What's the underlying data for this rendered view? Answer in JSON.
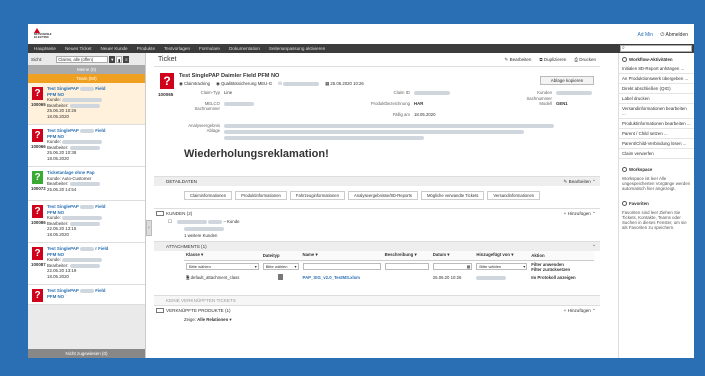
{
  "brand": {
    "logo_text": "MITSUBISHI ELECTRIC"
  },
  "user": {
    "name": "Ad Min",
    "logout": "Abmelden"
  },
  "nav": [
    "Hauptseite",
    "Neues Ticket",
    "Neuer Kunde",
    "Produkte",
    "Textvorlagen",
    "Formulare",
    "Dokumentation",
    "Seitenanpassung aktivieren"
  ],
  "left": {
    "sicht_label": "Sicht:",
    "sicht_value": "Claims, alle (offen)",
    "meine": "Meine (0)",
    "team": "Team (50)",
    "nicht": "Nicht zugewiesen (0)",
    "kunde_label": "Kunde:",
    "bearbeiter_label": "Bearbeiter:",
    "tickets": [
      {
        "title1": "Test SinglePAP",
        "title2": "Field",
        "title3": "PFM NO",
        "num": "100065",
        "d1": "25.06.20 10:26",
        "d2": "18.05.2020",
        "color": "#d0021b"
      },
      {
        "title1": "Test SinglePAP",
        "title2": "Field",
        "title3": "PFM NO",
        "num": "100066",
        "d1": "25.06.20 10:38",
        "d2": "18.05.2020",
        "color": "#d0021b"
      },
      {
        "title1": "Ticketanlage ohne Pap",
        "title2": "",
        "title3": "Kunde: Auto-Customer",
        "num": "100072",
        "d1": "25.06.20 14:54",
        "d2": "",
        "color": "#3aaa35"
      },
      {
        "title1": "Test SinglePAP",
        "title2": "Field",
        "title3": "PFM NO",
        "num": "100086",
        "d1": "22.05.20 13:15",
        "d2": "18.05.2020",
        "color": "#d0021b"
      },
      {
        "title1": "Test SinglePAP",
        "title2": "r Field",
        "title3": "PFM NO",
        "num": "100087",
        "d1": "22.05.20 13:19",
        "d2": "18.05.2020",
        "color": "#d0021b"
      },
      {
        "title1": "Test SinglePAP",
        "title2": "Field",
        "title3": "PFM NO",
        "num": "100088",
        "d1": "",
        "d2": "",
        "color": "#d0021b"
      }
    ]
  },
  "main": {
    "heading": "Ticket",
    "toolbar": {
      "edit": "Bearbeiten",
      "duplicate": "Duplizieren",
      "print": "Drucken"
    },
    "ticket": {
      "title": "Test SinglePAP Daimler Field PFM NO",
      "number": "100065",
      "flag1": "Claimtracking",
      "flag2": "Qualitätssicherung MEU-G",
      "date": "25.06.2020 10:26",
      "ablage": "Ablage kopieren",
      "claim_typ_label": "Claim-Typ",
      "claim_typ": "Line",
      "claim_id_label": "Claim ID",
      "kunden_label": "Kunden",
      "sachnummer_label": "Sachnummer",
      "meu_label": "MELCO Sachnummer",
      "produkt_label": "Produktbezeichnung",
      "produkt": "HAR",
      "model_label": "Modell",
      "model": "GEN1",
      "faellig_label": "Fällig am",
      "faellig": "18.05.2020",
      "analyse_label": "Analyseergebnis",
      "ablage_label": "Ablage",
      "headline": "Wiederholungsreklamation!"
    },
    "detaildaten": "DETAILDATEN",
    "tabs": [
      "Claiminformationen",
      "Produktinformationen",
      "Fahrzeuginformationen",
      "Analyseergebnisse/8D-Reports",
      "Mögliche verwandte Tickets",
      "Versandinformationen"
    ],
    "kunden": {
      "header": "KUNDEN (2)",
      "add": "+ Hinzufügen",
      "kunde_label": "Kunde",
      "more": "1 weitere Kunden"
    },
    "attachments": {
      "header": "ATTACHMENTS (1)",
      "cols": [
        "Klasse",
        "Dateityp",
        "Name",
        "Beschreibung",
        "Datum",
        "Hinzugefügt von",
        "Aktion"
      ],
      "filter_placeholder": "Bitte wählen",
      "apply": "Filter anwenden",
      "reset": "Filter zurücksetzen",
      "show": "Im Protokoll anzeigen",
      "row": {
        "klasse": "default_attachment_class",
        "name": "PAP_SIG_v2.0_TestMS.xlsm",
        "datum": "25.06.20 10:26"
      }
    },
    "keine": "KEINE VERKNÜPFTEN TICKETS",
    "produkte": {
      "header": "VERKNÜPFTE PRODUKTE (1)",
      "add": "+ Hinzufügen",
      "zeige_label": "Zeige:",
      "zeige_value": "Alle Relationen"
    }
  },
  "right": {
    "workflow_title": "Workflow-Aktivitäten",
    "workflow": [
      "Initialen 8D-Report anhängen ...",
      "An Produktionswerk übergeben ...",
      "Direkt abschließen (QIG)",
      "Label drucken",
      "Versandinformationen bearbeiten ...",
      "Produktinformationen bearbeiten ...",
      "Parent / Child setzen ...",
      "Parent/Child-Verbindung lösen ...",
      "Claim verwerfen"
    ],
    "workspace_title": "Workspace",
    "workspace_text": "Workspace ist leer Alle ungespeicherten Vorgänge werden automatisch hier angezeigt.",
    "favoriten_title": "Favoriten",
    "favoriten_text": "Favoriten sind leer Ziehen Sie Tickets, Kontakte, Teams oder Suchen in dieses Fenster, um sie als Favoriten zu speichern."
  }
}
